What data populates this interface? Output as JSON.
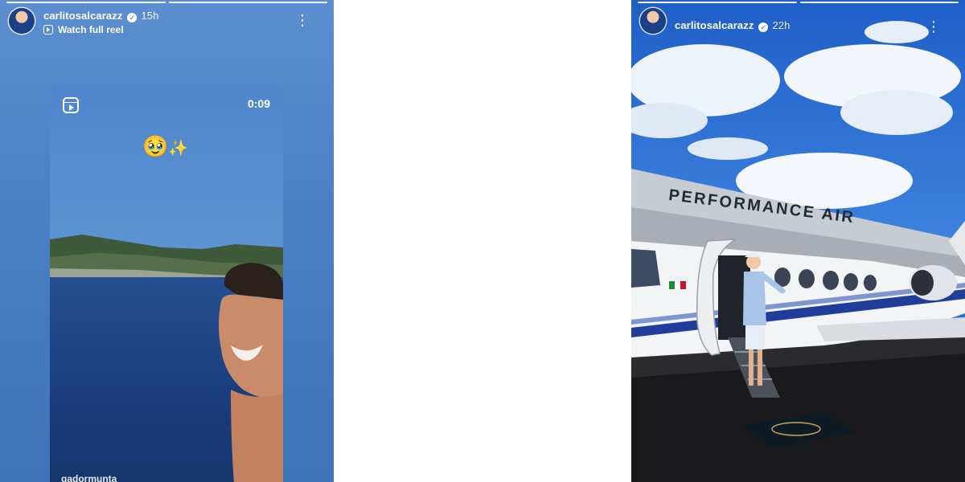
{
  "stories": [
    {
      "username": "carlitosalcarazz",
      "verified_mark": "✓",
      "time": "15h",
      "subline": "Watch full reel",
      "menu_icon": "kebab-icon",
      "reel": {
        "duration": "0:09",
        "emoji": "🥹",
        "sparkle": "✨",
        "author": "gadormunta"
      }
    },
    {
      "username": "carlitosalcarazz",
      "verified_mark": "✓",
      "time": "22h",
      "menu_icon": "kebab-icon",
      "photo": {
        "hangar_sign": "PERFORMANCE AIR"
      }
    }
  ],
  "colors": {
    "left_bg": "#4a7fc4",
    "sky": "#2b6fd8",
    "tarmac": "#1a1a1c"
  }
}
